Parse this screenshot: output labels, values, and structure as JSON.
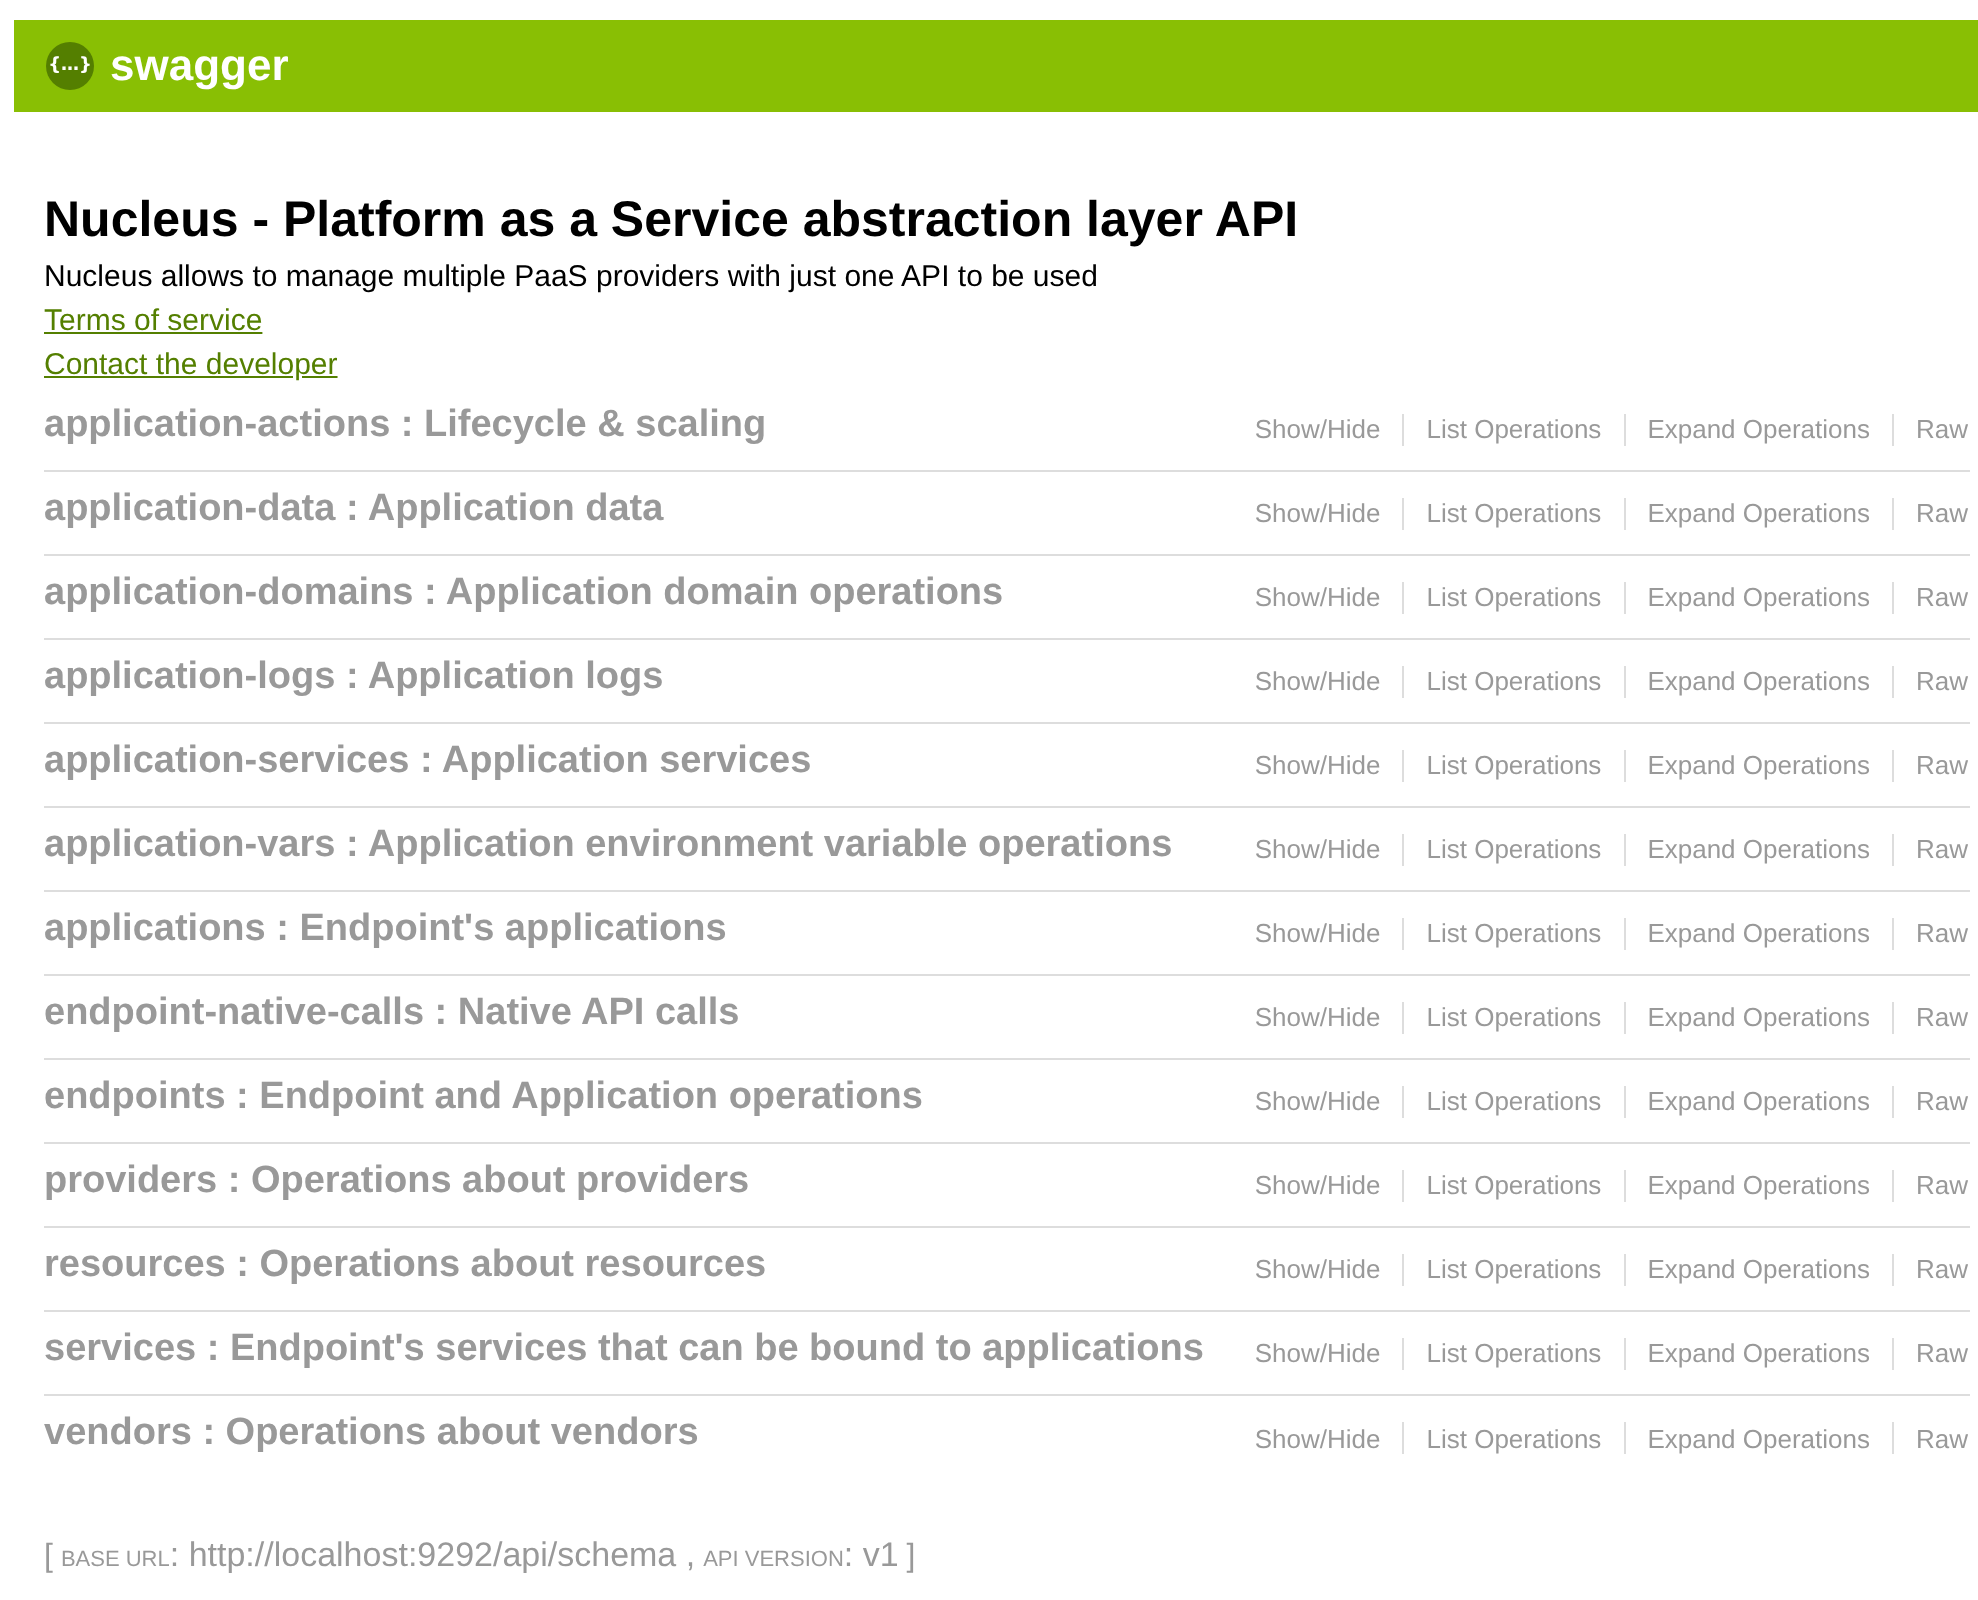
{
  "header": {
    "logo_glyph": "{…}",
    "title": "swagger"
  },
  "info": {
    "title": "Nucleus - Platform as a Service abstraction layer API",
    "description": "Nucleus allows to manage multiple PaaS providers with just one API to be used",
    "links": [
      "Terms of service",
      "Contact the developer"
    ]
  },
  "resources": [
    {
      "heading": "application-actions : Lifecycle & scaling",
      "actions": [
        "Show/Hide",
        "List Operations",
        "Expand Operations",
        "Raw"
      ]
    },
    {
      "heading": "application-data : Application data",
      "actions": [
        "Show/Hide",
        "List Operations",
        "Expand Operations",
        "Raw"
      ]
    },
    {
      "heading": "application-domains : Application domain operations",
      "actions": [
        "Show/Hide",
        "List Operations",
        "Expand Operations",
        "Raw"
      ]
    },
    {
      "heading": "application-logs : Application logs",
      "actions": [
        "Show/Hide",
        "List Operations",
        "Expand Operations",
        "Raw"
      ]
    },
    {
      "heading": "application-services : Application services",
      "actions": [
        "Show/Hide",
        "List Operations",
        "Expand Operations",
        "Raw"
      ]
    },
    {
      "heading": "application-vars : Application environment variable operations",
      "actions": [
        "Show/Hide",
        "List Operations",
        "Expand Operations",
        "Raw"
      ]
    },
    {
      "heading": "applications : Endpoint's applications",
      "actions": [
        "Show/Hide",
        "List Operations",
        "Expand Operations",
        "Raw"
      ]
    },
    {
      "heading": "endpoint-native-calls : Native API calls",
      "actions": [
        "Show/Hide",
        "List Operations",
        "Expand Operations",
        "Raw"
      ]
    },
    {
      "heading": "endpoints : Endpoint and Application operations",
      "actions": [
        "Show/Hide",
        "List Operations",
        "Expand Operations",
        "Raw"
      ]
    },
    {
      "heading": "providers : Operations about providers",
      "actions": [
        "Show/Hide",
        "List Operations",
        "Expand Operations",
        "Raw"
      ]
    },
    {
      "heading": "resources : Operations about resources",
      "actions": [
        "Show/Hide",
        "List Operations",
        "Expand Operations",
        "Raw"
      ]
    },
    {
      "heading": "services : Endpoint's services that can be bound to applications",
      "actions": [
        "Show/Hide",
        "List Operations",
        "Expand Operations",
        "Raw"
      ]
    },
    {
      "heading": "vendors : Operations about vendors",
      "actions": [
        "Show/Hide",
        "List Operations",
        "Expand Operations",
        "Raw"
      ]
    }
  ],
  "footer": {
    "open": "[",
    "base_url_label": "BASE URL",
    "base_url": ": http://localhost:9292/api/schema ,",
    "api_version_label": "API VERSION",
    "api_version": ": v1",
    "close": "]"
  }
}
